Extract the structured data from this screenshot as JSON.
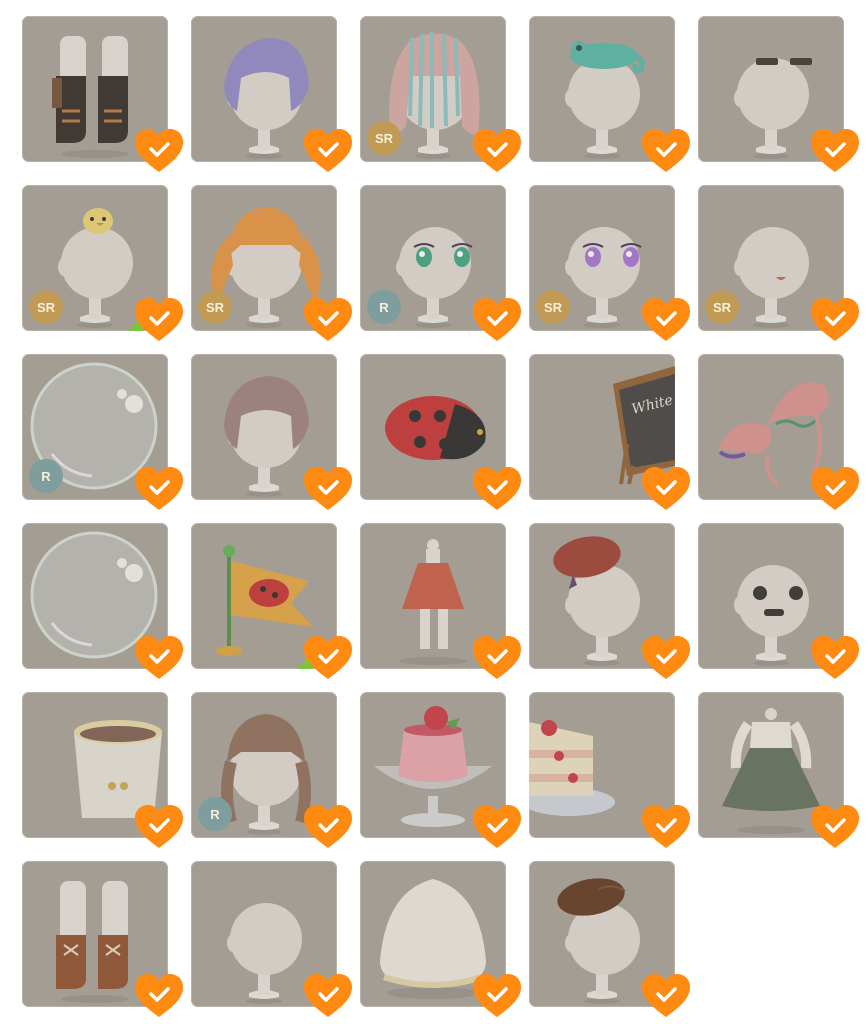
{
  "colors": {
    "tile_bg": "#a39d94",
    "heart": "#ff8a12",
    "badge_sr": "#c19a55",
    "badge_r": "#7e9d9d",
    "corner_flag": "#7cc43a"
  },
  "tiles": [
    {
      "item": "black-boots-icon",
      "rarity": "",
      "owned": true
    },
    {
      "item": "purple-short-hair-icon",
      "rarity": "",
      "owned": true
    },
    {
      "item": "pastel-striped-hair-icon",
      "rarity": "SR",
      "owned": true
    },
    {
      "item": "chameleon-head-accessory-icon",
      "rarity": "",
      "owned": true
    },
    {
      "item": "dash-eyebrows-icon",
      "rarity": "",
      "owned": true
    },
    {
      "item": "chick-head-accessory-icon",
      "rarity": "SR",
      "owned": true
    },
    {
      "item": "orange-twin-tail-hair-icon",
      "rarity": "SR",
      "owned": true
    },
    {
      "item": "green-eyes-icon",
      "rarity": "R",
      "owned": true
    },
    {
      "item": "purple-eyes-icon",
      "rarity": "SR",
      "owned": true
    },
    {
      "item": "open-mouth-icon",
      "rarity": "SR",
      "owned": true
    },
    {
      "item": "soap-bubble-icon",
      "rarity": "R",
      "owned": true
    },
    {
      "item": "brown-short-hair-icon",
      "rarity": "",
      "owned": true
    },
    {
      "item": "ladybug-icon",
      "rarity": "",
      "owned": true
    },
    {
      "item": "chalkboard-sign-icon",
      "rarity": "",
      "owned": true
    },
    {
      "item": "jellyfish-plants-icon",
      "rarity": "",
      "owned": true
    },
    {
      "item": "soap-bubble-icon",
      "rarity": "",
      "owned": true
    },
    {
      "item": "ladybug-flag-icon",
      "rarity": "",
      "owned": true
    },
    {
      "item": "red-dress-icon",
      "rarity": "",
      "owned": true
    },
    {
      "item": "red-beret-icon",
      "rarity": "",
      "owned": true
    },
    {
      "item": "round-eyes-mustache-icon",
      "rarity": "",
      "owned": true
    },
    {
      "item": "cocoa-mug-icon",
      "rarity": "",
      "owned": true
    },
    {
      "item": "brown-braided-hair-icon",
      "rarity": "R",
      "owned": true
    },
    {
      "item": "strawberry-pudding-icon",
      "rarity": "",
      "owned": true
    },
    {
      "item": "strawberry-shortcake-icon",
      "rarity": "",
      "owned": true
    },
    {
      "item": "green-dress-icon",
      "rarity": "",
      "owned": true
    },
    {
      "item": "brown-boots-icon",
      "rarity": "",
      "owned": true
    },
    {
      "item": "blank-head-icon",
      "rarity": "",
      "owned": true
    },
    {
      "item": "rice-ball-icon",
      "rarity": "",
      "owned": true
    },
    {
      "item": "brown-beret-icon",
      "rarity": "",
      "owned": true
    }
  ],
  "chalkboard_text": "White Day"
}
